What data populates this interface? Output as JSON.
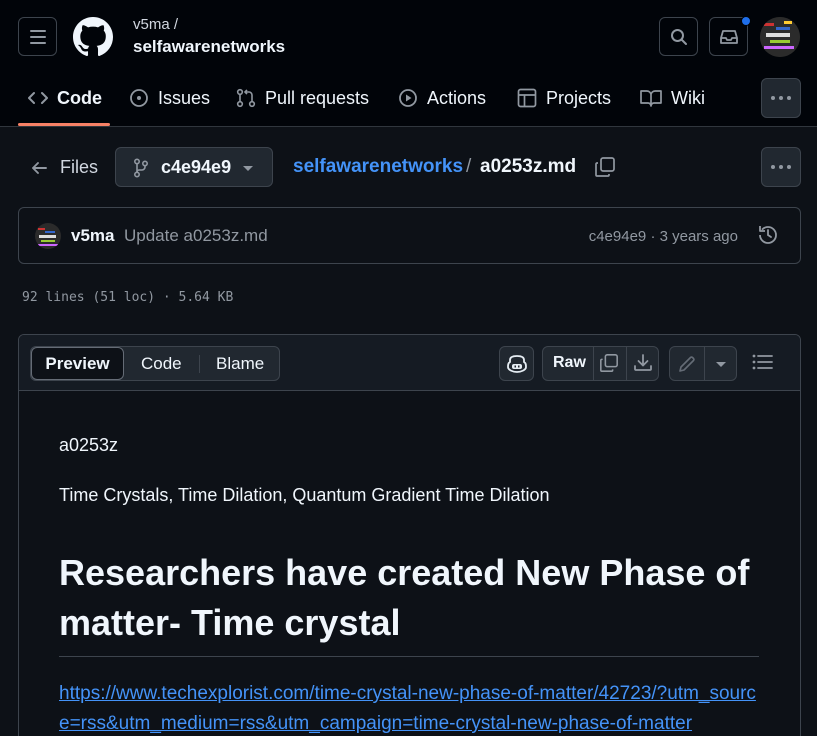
{
  "header": {
    "owner": "v5ma /",
    "repo": "selfawarenetworks",
    "icons": [
      "menu-icon",
      "github-logo-icon",
      "search-icon",
      "inbox-icon",
      "user-avatar"
    ]
  },
  "nav": {
    "items": [
      {
        "label": "Code",
        "icon": "code-icon",
        "selected": true
      },
      {
        "label": "Issues",
        "icon": "issue-icon"
      },
      {
        "label": "Pull requests",
        "icon": "pull-request-icon"
      },
      {
        "label": "Actions",
        "icon": "play-icon"
      },
      {
        "label": "Projects",
        "icon": "table-icon"
      },
      {
        "label": "Wiki",
        "icon": "book-icon"
      }
    ]
  },
  "breadcrumb": {
    "files_label": "Files",
    "branch": "c4e94e9",
    "repo_link": "selfawarenetworks",
    "separator": "/",
    "file": "a0253z.md"
  },
  "commit": {
    "author": "v5ma",
    "message": "Update a0253z.md",
    "meta": "c4e94e9 · 3 years ago"
  },
  "file_info": "92 lines (51 loc) · 5.64 KB",
  "file_tabs": {
    "preview": "Preview",
    "code": "Code",
    "blame": "Blame",
    "raw": "Raw"
  },
  "content": {
    "p1": "a0253z",
    "p2": "Time Crystals, Time Dilation, Quantum Gradient Time Dilation",
    "h1": "Researchers have created New Phase of matter- Time crystal",
    "link": "https://www.techexplorist.com/time-crystal-new-phase-of-matter/42723/?utm_source=rss&utm_medium=rss&utm_campaign=time-crystal-new-phase-of-matter"
  },
  "colors": {
    "accent_link": "#4493f8",
    "tab_underline": "#f78166",
    "notification_dot": "#1f6feb"
  }
}
